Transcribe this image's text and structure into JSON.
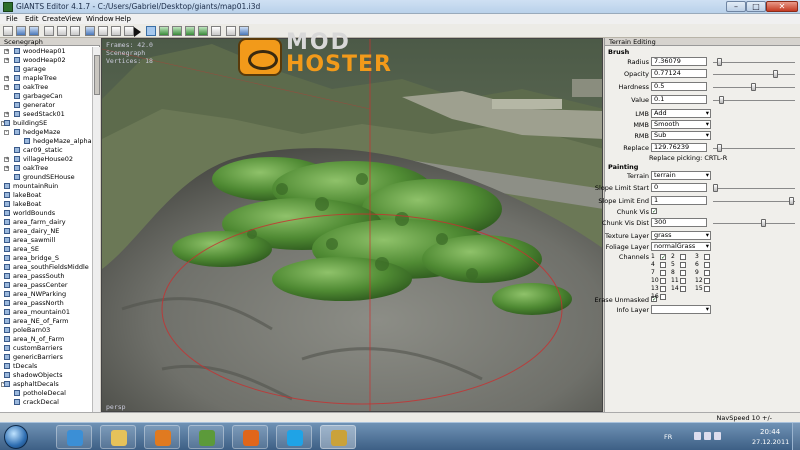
{
  "window": {
    "title": "GIANTS Editor 4.1.7 - C:/Users/Gabriel/Desktop/giants/map01.i3d",
    "minimize": "–",
    "maximize": "□",
    "close": "✕"
  },
  "menu": [
    "File",
    "Edit",
    "Create",
    "View",
    "Window",
    "Help"
  ],
  "scenegraph": {
    "title": "Scenegraph",
    "items": [
      {
        "label": "woodHeap01",
        "indent": 14,
        "expander": "+"
      },
      {
        "label": "woodHeap02",
        "indent": 14,
        "expander": "+"
      },
      {
        "label": "garage",
        "indent": 14,
        "expander": ""
      },
      {
        "label": "mapleTree",
        "indent": 14,
        "expander": "+"
      },
      {
        "label": "oakTree",
        "indent": 14,
        "expander": "+"
      },
      {
        "label": "garbageCan",
        "indent": 14,
        "expander": ""
      },
      {
        "label": "generator",
        "indent": 14,
        "expander": ""
      },
      {
        "label": "seedStack01",
        "indent": 14,
        "expander": "+"
      },
      {
        "label": "buildingSE",
        "indent": 4,
        "expander": "-"
      },
      {
        "label": "hedgeMaze",
        "indent": 14,
        "expander": "-"
      },
      {
        "label": "hedgeMaze_alpha",
        "indent": 24,
        "expander": ""
      },
      {
        "label": "car09_static",
        "indent": 14,
        "expander": ""
      },
      {
        "label": "villageHouse02",
        "indent": 14,
        "expander": "+"
      },
      {
        "label": "oakTree",
        "indent": 14,
        "expander": "+"
      },
      {
        "label": "groundSEHouse",
        "indent": 14,
        "expander": ""
      },
      {
        "label": "mountainRuin",
        "indent": 4,
        "expander": ""
      },
      {
        "label": "lakeBoat",
        "indent": 4,
        "expander": ""
      },
      {
        "label": "lakeBoat",
        "indent": 4,
        "expander": ""
      },
      {
        "label": "worldBounds",
        "indent": 4,
        "expander": ""
      },
      {
        "label": "area_farm_dairy",
        "indent": 4,
        "expander": ""
      },
      {
        "label": "area_dairy_NE",
        "indent": 4,
        "expander": ""
      },
      {
        "label": "area_sawmill",
        "indent": 4,
        "expander": ""
      },
      {
        "label": "area_SE",
        "indent": 4,
        "expander": ""
      },
      {
        "label": "area_bridge_S",
        "indent": 4,
        "expander": ""
      },
      {
        "label": "area_southFieldsMiddle",
        "indent": 4,
        "expander": ""
      },
      {
        "label": "area_passSouth",
        "indent": 4,
        "expander": ""
      },
      {
        "label": "area_passCenter",
        "indent": 4,
        "expander": ""
      },
      {
        "label": "area_NWParking",
        "indent": 4,
        "expander": ""
      },
      {
        "label": "area_passNorth",
        "indent": 4,
        "expander": ""
      },
      {
        "label": "area_mountain01",
        "indent": 4,
        "expander": ""
      },
      {
        "label": "area_NE_of_Farm",
        "indent": 4,
        "expander": ""
      },
      {
        "label": "poleBarn03",
        "indent": 4,
        "expander": ""
      },
      {
        "label": "area_N_of_Farm",
        "indent": 4,
        "expander": ""
      },
      {
        "label": "customBarriers",
        "indent": 4,
        "expander": ""
      },
      {
        "label": "genericBarriers",
        "indent": 4,
        "expander": ""
      },
      {
        "label": "tDecals",
        "indent": 4,
        "expander": ""
      },
      {
        "label": "shadowObjects",
        "indent": 4,
        "expander": ""
      },
      {
        "label": "asphaltDecals",
        "indent": 4,
        "expander": "-"
      },
      {
        "label": "potholeDecal",
        "indent": 14,
        "expander": ""
      },
      {
        "label": "crackDecal",
        "indent": 14,
        "expander": ""
      }
    ]
  },
  "viewport": {
    "overlay_lines": [
      "Frames: 42.0",
      "Scenegraph",
      "Vertices: 18"
    ],
    "bottom_label": "persp"
  },
  "logo": {
    "line1": "MOD",
    "line2": "HOSTER"
  },
  "terrain": {
    "title": "Terrain Editing",
    "brush_header": "Brush",
    "radius_label": "Radius",
    "radius_value": "7.36079",
    "opacity_label": "Opacity",
    "opacity_value": "0.77124",
    "hardness_label": "Hardness",
    "hardness_value": "0.5",
    "value_label": "Value",
    "value_value": "0.1",
    "lmb_label": "LMB",
    "lmb_value": "Add",
    "mmb_label": "MMB",
    "mmb_value": "Smooth",
    "rmb_label": "RMB",
    "rmb_value": "Sub",
    "replace_label": "Replace",
    "replace_value": "129.76239",
    "replace_picking": "Replace picking: CRTL-R",
    "painting_header": "Painting",
    "terrain_label": "Terrain",
    "terrain_value": "terrain",
    "slope_start_label": "Slope Limit Start",
    "slope_start_value": "0",
    "slope_end_label": "Slope Limit End",
    "slope_end_value": "1",
    "chunk_vis_label": "Chunk Vis",
    "chunk_vis_checked": "✓",
    "chunk_vis_dist_label": "Chunk Vis Dist",
    "chunk_vis_dist_value": "300",
    "texture_layer_label": "Texture Layer",
    "texture_layer_value": "grass",
    "foliage_layer_label": "Foliage Layer",
    "foliage_layer_value": "normalGrass",
    "channels_label": "Channels",
    "channels": [
      {
        "n": "1",
        "checked": "✓"
      },
      {
        "n": "2",
        "checked": ""
      },
      {
        "n": "3",
        "checked": ""
      },
      {
        "n": "4",
        "checked": ""
      },
      {
        "n": "5",
        "checked": ""
      },
      {
        "n": "6",
        "checked": ""
      },
      {
        "n": "7",
        "checked": ""
      },
      {
        "n": "8",
        "checked": ""
      },
      {
        "n": "9",
        "checked": ""
      },
      {
        "n": "10",
        "checked": ""
      },
      {
        "n": "11",
        "checked": ""
      },
      {
        "n": "12",
        "checked": ""
      },
      {
        "n": "13",
        "checked": ""
      },
      {
        "n": "14",
        "checked": ""
      },
      {
        "n": "15",
        "checked": ""
      },
      {
        "n": "16",
        "checked": ""
      }
    ],
    "erase_unmasked_label": "Erase Unmasked",
    "erase_unmasked_checked": "✓",
    "info_layer_label": "Info Layer",
    "info_layer_value": ""
  },
  "statusbar": {
    "navspeed": "NavSpeed 10 +/-"
  },
  "taskbar": {
    "language": "FR",
    "time": "20:44",
    "date": "27.12.2011",
    "apps": [
      {
        "name": "internet-explorer",
        "color": "#3b8fd6"
      },
      {
        "name": "file-explorer",
        "color": "#e6c25a"
      },
      {
        "name": "media-player",
        "color": "#e07a20"
      },
      {
        "name": "app-generic",
        "color": "#5c9a3a"
      },
      {
        "name": "firefox",
        "color": "#e0661a"
      },
      {
        "name": "skype",
        "color": "#1fa3e6"
      },
      {
        "name": "giants-editor",
        "color": "#caa23a"
      }
    ]
  }
}
